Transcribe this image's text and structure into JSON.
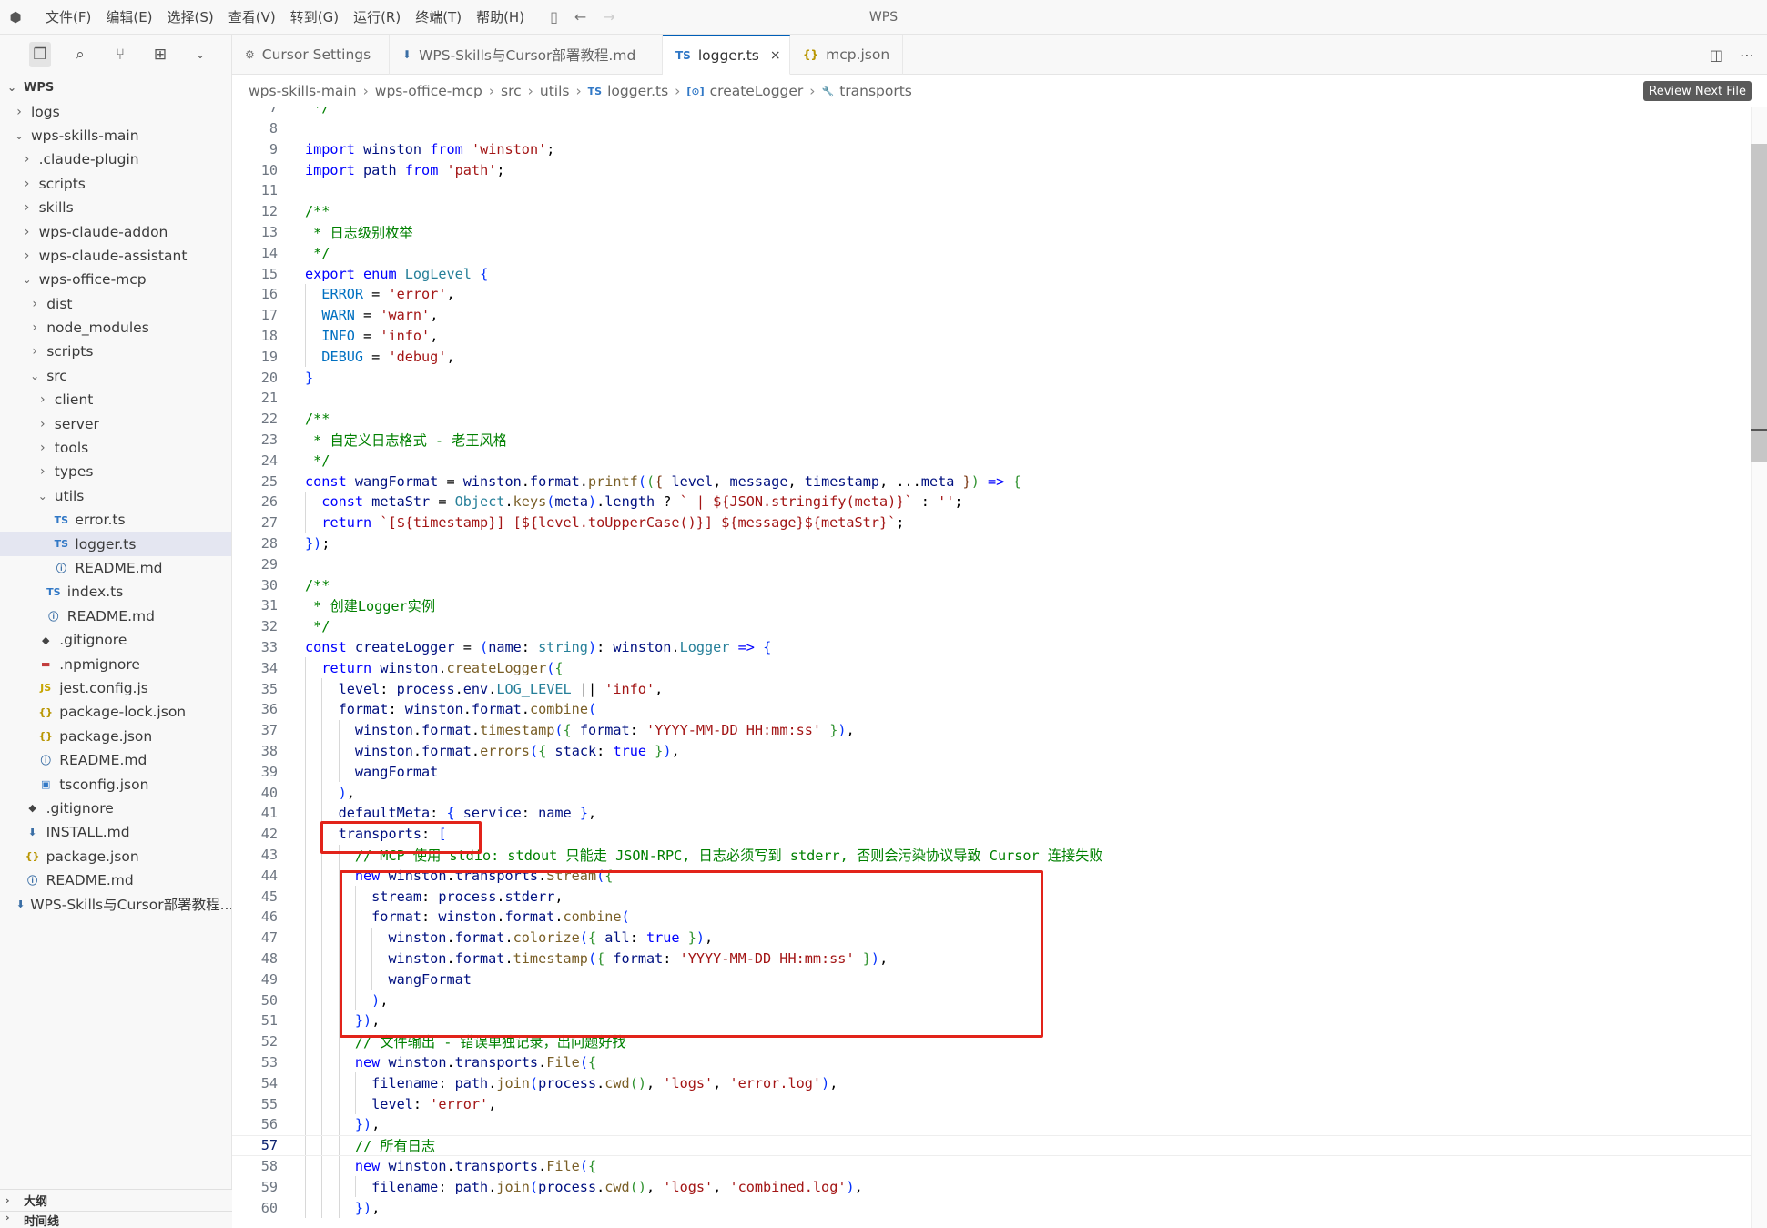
{
  "titlebar": {
    "menu": [
      "文件(F)",
      "编辑(E)",
      "选择(S)",
      "查看(V)",
      "转到(G)",
      "运行(R)",
      "终端(T)",
      "帮助(H)"
    ],
    "app_title": "WPS"
  },
  "tabs": [
    {
      "label": "Cursor Settings",
      "icon": "settings-gear-icon",
      "active": false
    },
    {
      "label": "WPS-Skills与Cursor部署教程.md",
      "icon": "markdown-download-icon",
      "active": false
    },
    {
      "label": "logger.ts",
      "icon": "TS",
      "active": true,
      "close": "×"
    },
    {
      "label": "mcp.json",
      "icon": "{}",
      "active": false
    }
  ],
  "explorer": {
    "root": "WPS",
    "items": [
      {
        "label": "logs",
        "type": "folder",
        "open": false,
        "depth": 1
      },
      {
        "label": "wps-skills-main",
        "type": "folder",
        "open": true,
        "depth": 1
      },
      {
        "label": ".claude-plugin",
        "type": "folder",
        "open": false,
        "depth": 2
      },
      {
        "label": "scripts",
        "type": "folder",
        "open": false,
        "depth": 2
      },
      {
        "label": "skills",
        "type": "folder",
        "open": false,
        "depth": 2
      },
      {
        "label": "wps-claude-addon",
        "type": "folder",
        "open": false,
        "depth": 2
      },
      {
        "label": "wps-claude-assistant",
        "type": "folder",
        "open": false,
        "depth": 2
      },
      {
        "label": "wps-office-mcp",
        "type": "folder",
        "open": true,
        "depth": 2
      },
      {
        "label": "dist",
        "type": "folder",
        "open": false,
        "depth": 3
      },
      {
        "label": "node_modules",
        "type": "folder",
        "open": false,
        "depth": 3
      },
      {
        "label": "scripts",
        "type": "folder",
        "open": false,
        "depth": 3
      },
      {
        "label": "src",
        "type": "folder",
        "open": true,
        "depth": 3
      },
      {
        "label": "client",
        "type": "folder",
        "open": false,
        "depth": 4
      },
      {
        "label": "server",
        "type": "folder",
        "open": false,
        "depth": 4
      },
      {
        "label": "tools",
        "type": "folder",
        "open": false,
        "depth": 4
      },
      {
        "label": "types",
        "type": "folder",
        "open": false,
        "depth": 4
      },
      {
        "label": "utils",
        "type": "folder",
        "open": true,
        "depth": 4
      },
      {
        "label": "error.ts",
        "type": "ts",
        "depth": 5
      },
      {
        "label": "logger.ts",
        "type": "ts",
        "depth": 5,
        "selected": true
      },
      {
        "label": "README.md",
        "type": "info",
        "depth": 5
      },
      {
        "label": "index.ts",
        "type": "ts",
        "depth": 4
      },
      {
        "label": "README.md",
        "type": "info",
        "depth": 4
      },
      {
        "label": ".gitignore",
        "type": "git",
        "depth": 3
      },
      {
        "label": ".npmignore",
        "type": "npm",
        "depth": 3
      },
      {
        "label": "jest.config.js",
        "type": "js",
        "depth": 3
      },
      {
        "label": "package-lock.json",
        "type": "json",
        "depth": 3
      },
      {
        "label": "package.json",
        "type": "json",
        "depth": 3
      },
      {
        "label": "README.md",
        "type": "info",
        "depth": 3
      },
      {
        "label": "tsconfig.json",
        "type": "tsconfig",
        "depth": 3
      },
      {
        "label": ".gitignore",
        "type": "git",
        "depth": 2
      },
      {
        "label": "INSTALL.md",
        "type": "mddl",
        "depth": 2
      },
      {
        "label": "package.json",
        "type": "json",
        "depth": 2
      },
      {
        "label": "README.md",
        "type": "info",
        "depth": 2
      },
      {
        "label": "WPS-Skills与Cursor部署教程....",
        "type": "mddl",
        "depth": 1
      }
    ],
    "outline_label": "大纲",
    "timeline_label": "时间线"
  },
  "breadcrumb": {
    "items": [
      "wps-skills-main",
      "wps-office-mcp",
      "src",
      "utils",
      "logger.ts",
      "createLogger",
      "transports"
    ],
    "review_button": "Review Next File"
  },
  "editor": {
    "current_line": 57,
    "lines": [
      {
        "n": 7,
        "t": " */"
      },
      {
        "n": 8,
        "t": ""
      },
      {
        "n": 9,
        "t": "import winston from 'winston';"
      },
      {
        "n": 10,
        "t": "import path from 'path';"
      },
      {
        "n": 11,
        "t": ""
      },
      {
        "n": 12,
        "t": "/**"
      },
      {
        "n": 13,
        "t": " * 日志级别枚举"
      },
      {
        "n": 14,
        "t": " */"
      },
      {
        "n": 15,
        "t": "export enum LogLevel {"
      },
      {
        "n": 16,
        "t": "  ERROR = 'error',"
      },
      {
        "n": 17,
        "t": "  WARN = 'warn',"
      },
      {
        "n": 18,
        "t": "  INFO = 'info',"
      },
      {
        "n": 19,
        "t": "  DEBUG = 'debug',"
      },
      {
        "n": 20,
        "t": "}"
      },
      {
        "n": 21,
        "t": ""
      },
      {
        "n": 22,
        "t": "/**"
      },
      {
        "n": 23,
        "t": " * 自定义日志格式 - 老王风格"
      },
      {
        "n": 24,
        "t": " */"
      },
      {
        "n": 25,
        "t": "const wangFormat = winston.format.printf(({ level, message, timestamp, ...meta }) => {"
      },
      {
        "n": 26,
        "t": "  const metaStr = Object.keys(meta).length ? ` | ${JSON.stringify(meta)}` : '';"
      },
      {
        "n": 27,
        "t": "  return `[${timestamp}] [${level.toUpperCase()}] ${message}${metaStr}`;"
      },
      {
        "n": 28,
        "t": "});"
      },
      {
        "n": 29,
        "t": ""
      },
      {
        "n": 30,
        "t": "/**"
      },
      {
        "n": 31,
        "t": " * 创建Logger实例"
      },
      {
        "n": 32,
        "t": " */"
      },
      {
        "n": 33,
        "t": "const createLogger = (name: string): winston.Logger => {"
      },
      {
        "n": 34,
        "t": "  return winston.createLogger({"
      },
      {
        "n": 35,
        "t": "    level: process.env.LOG_LEVEL || 'info',"
      },
      {
        "n": 36,
        "t": "    format: winston.format.combine("
      },
      {
        "n": 37,
        "t": "      winston.format.timestamp({ format: 'YYYY-MM-DD HH:mm:ss' }),"
      },
      {
        "n": 38,
        "t": "      winston.format.errors({ stack: true }),"
      },
      {
        "n": 39,
        "t": "      wangFormat"
      },
      {
        "n": 40,
        "t": "    ),"
      },
      {
        "n": 41,
        "t": "    defaultMeta: { service: name },"
      },
      {
        "n": 42,
        "t": "    transports: ["
      },
      {
        "n": 43,
        "t": "      // MCP 使用 stdio: stdout 只能走 JSON-RPC, 日志必须写到 stderr, 否则会污染协议导致 Cursor 连接失败"
      },
      {
        "n": 44,
        "t": "      new winston.transports.Stream({"
      },
      {
        "n": 45,
        "t": "        stream: process.stderr,"
      },
      {
        "n": 46,
        "t": "        format: winston.format.combine("
      },
      {
        "n": 47,
        "t": "          winston.format.colorize({ all: true }),"
      },
      {
        "n": 48,
        "t": "          winston.format.timestamp({ format: 'YYYY-MM-DD HH:mm:ss' }),"
      },
      {
        "n": 49,
        "t": "          wangFormat"
      },
      {
        "n": 50,
        "t": "        ),"
      },
      {
        "n": 51,
        "t": "      }),"
      },
      {
        "n": 52,
        "t": "      // 文件输出 - 错误单独记录，出问题好找"
      },
      {
        "n": 53,
        "t": "      new winston.transports.File({"
      },
      {
        "n": 54,
        "t": "        filename: path.join(process.cwd(), 'logs', 'error.log'),"
      },
      {
        "n": 55,
        "t": "        level: 'error',"
      },
      {
        "n": 56,
        "t": "      }),"
      },
      {
        "n": 57,
        "t": "      // 所有日志"
      },
      {
        "n": 58,
        "t": "      new winston.transports.File({"
      },
      {
        "n": 59,
        "t": "        filename: path.join(process.cwd(), 'logs', 'combined.log'),"
      },
      {
        "n": 60,
        "t": "      }),"
      }
    ]
  },
  "colors": {
    "accent": "#005fb8",
    "highlight_box": "#e2231a",
    "keyword": "#0000ff",
    "string": "#a31515",
    "comment": "#008000"
  }
}
